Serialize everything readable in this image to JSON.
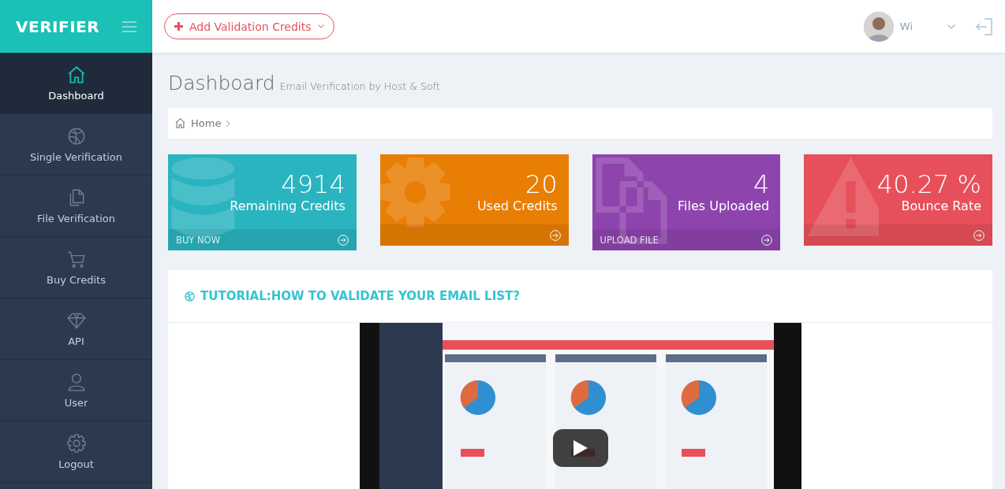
{
  "brand": "VERIFIER",
  "add_credits_button": "Add Validation Credits",
  "user": {
    "name": "Wi"
  },
  "sidebar": {
    "items": [
      {
        "label": "Dashboard",
        "kind": "home",
        "selected": true
      },
      {
        "label": "Single Verification",
        "kind": "ball",
        "selected": false
      },
      {
        "label": "File Verification",
        "kind": "files",
        "selected": false
      },
      {
        "label": "Buy Credits",
        "kind": "cart",
        "selected": false
      },
      {
        "label": "API",
        "kind": "diamond",
        "selected": false
      },
      {
        "label": "User",
        "kind": "user",
        "selected": false
      },
      {
        "label": "Logout",
        "kind": "gear",
        "selected": false
      }
    ]
  },
  "page": {
    "title": "Dashboard",
    "subtitle": "Email Verification by Host & Soft"
  },
  "breadcrumb": [
    "Home"
  ],
  "stats": [
    {
      "value": "4914",
      "label": "Remaining Credits",
      "link": "BUY NOW",
      "color": "#2ab4c0",
      "kind": "database"
    },
    {
      "value": "20",
      "label": "Used Credits",
      "color": "#e87e04",
      "kind": "gear"
    },
    {
      "value": "4",
      "label": "Files Uploaded",
      "link": "UPLOAD FILE",
      "color": "#8e44ad",
      "kind": "files"
    },
    {
      "value": "40.27 %",
      "label": "Bounce Rate",
      "color": "#e7505a",
      "kind": "warning"
    }
  ],
  "tutorial": {
    "title": "TUTORIAL:HOW TO VALIDATE YOUR EMAIL LIST?"
  }
}
